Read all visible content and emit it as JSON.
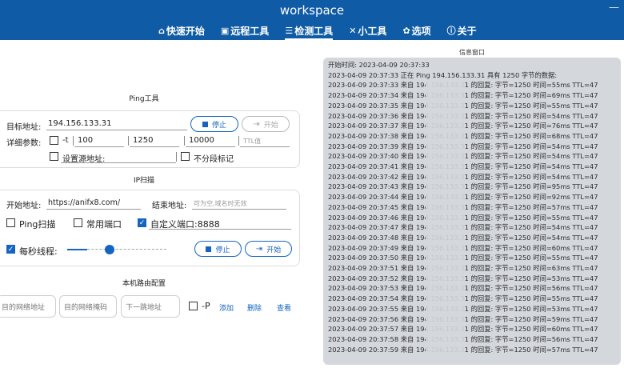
{
  "app": {
    "title": "workspace"
  },
  "nav": [
    {
      "icon": "home-icon",
      "glyph": "⌂",
      "label": "快速开始",
      "active": false
    },
    {
      "icon": "remote-icon",
      "glyph": "▣",
      "label": "远程工具",
      "active": false
    },
    {
      "icon": "wifi-icon",
      "glyph": "☰",
      "label": "检测工具",
      "active": true
    },
    {
      "icon": "tools-icon",
      "glyph": "✕",
      "label": "小工具",
      "active": false
    },
    {
      "icon": "gear-icon",
      "glyph": "✿",
      "label": "选项",
      "active": false
    },
    {
      "icon": "info-icon",
      "glyph": "ⓘ",
      "label": "关于",
      "active": false
    }
  ],
  "ping": {
    "title": "Ping工具",
    "target_label": "目标地址:",
    "target_value": "194.156.133.31",
    "stop_label": "停止",
    "start_label": "开始",
    "detail_label": "详细参数:",
    "t_label": "-t",
    "count": "100",
    "size": "1250",
    "timeout": "10000",
    "ttl_placeholder": "TTL值",
    "source_label": "设置源地址:",
    "nofrag_label": "不分段标记"
  },
  "ipscan": {
    "title": "IP扫描",
    "start_label": "开始地址:",
    "start_value": "https://anifx8.com/",
    "end_label": "结束地址:",
    "end_placeholder": "可为空,域名时无效",
    "ping_scan": "Ping扫描",
    "common_ports": "常用端口",
    "custom_port": "自定义端口:8888",
    "threads_label": "每秒线程:",
    "slider_fraction": 0.2,
    "stop_label": "停止",
    "start_btn": "开始"
  },
  "route": {
    "title": "本机路由配置",
    "dest_placeholder": "目的网络地址",
    "mask_placeholder": "目的网络掩码",
    "gateway_placeholder": "下一跳地址",
    "p_label": "-P",
    "add": "添加",
    "delete": "删除",
    "view": "查看"
  },
  "info": {
    "title": "信息窗口",
    "lines": [
      "开始时间:  2023-04-09 20:37:33",
      "2023-04-09 20:37:33  正在 Ping 194.156.133.31 具有 1250 字节的数据:",
      "2023-04-09 20:37:33  来自 194.156.133.31 的回复: 字节=1250 时间=55ms TTL=47",
      "2023-04-09 20:37:34  来自 194.156.133.31 的回复: 字节=1250 时间=69ms TTL=47",
      "2023-04-09 20:37:35  来自 194.156.133.31 的回复: 字节=1250 时间=55ms TTL=47",
      "2023-04-09 20:37:36  来自 194.156.133.31 的回复: 字节=1250 时间=54ms TTL=47",
      "2023-04-09 20:37:37  来自 194.156.133.31 的回复: 字节=1250 时间=76ms TTL=47",
      "2023-04-09 20:37:38  来自 194.156.133.31 的回复: 字节=1250 时间=68ms TTL=47",
      "2023-04-09 20:37:39  来自 194.156.133.31 的回复: 字节=1250 时间=54ms TTL=47",
      "2023-04-09 20:37:40  来自 194.156.133.31 的回复: 字节=1250 时间=54ms TTL=47",
      "2023-04-09 20:37:41  来自 194.156.133.31 的回复: 字节=1250 时间=54ms TTL=47",
      "2023-04-09 20:37:42  来自 194.156.133.31 的回复: 字节=1250 时间=54ms TTL=47",
      "2023-04-09 20:37:43  来自 194.156.133.31 的回复: 字节=1250 时间=95ms TTL=47",
      "2023-04-09 20:37:44  来自 194.156.133.31 的回复: 字节=1250 时间=92ms TTL=47",
      "2023-04-09 20:37:45  来自 194.156.133.31 的回复: 字节=1250 时间=57ms TTL=47",
      "2023-04-09 20:37:46  来自 194.156.133.31 的回复: 字节=1250 时间=55ms TTL=47",
      "2023-04-09 20:37:47  来自 194.156.133.31 的回复: 字节=1250 时间=54ms TTL=47",
      "2023-04-09 20:37:48  来自 194.156.133.31 的回复: 字节=1250 时间=54ms TTL=47",
      "2023-04-09 20:37:49  来自 194.156.133.31 的回复: 字节=1250 时间=60ms TTL=47",
      "2023-04-09 20:37:50  来自 194.156.133.31 的回复: 字节=1250 时间=55ms TTL=47",
      "2023-04-09 20:37:51  来自 194.156.133.31 的回复: 字节=1250 时间=63ms TTL=47",
      "2023-04-09 20:37:52  来自 194.156.133.31 的回复: 字节=1250 时间=53ms TTL=47",
      "2023-04-09 20:37:53  来自 194.156.133.31 的回复: 字节=1250 时间=56ms TTL=47",
      "2023-04-09 20:37:54  来自 194.156.133.31 的回复: 字节=1250 时间=55ms TTL=47",
      "2023-04-09 20:37:55  来自 194.156.133.31 的回复: 字节=1250 时间=53ms TTL=47",
      "2023-04-09 20:37:56  来自 194.156.133.31 的回复: 字节=1250 时间=59ms TTL=47",
      "2023-04-09 20:37:57  来自 194.156.133.31 的回复: 字节=1250 时间=60ms TTL=47",
      "2023-04-09 20:37:58  来自 194.156.133.31 的回复: 字节=1250 时间=56ms TTL=47",
      "2023-04-09 20:37:59  来自 194.156.133.31 的回复: 字节=1250 时间=57ms TTL=47"
    ]
  },
  "colors": {
    "titlebar": "#0f5ba6",
    "accent": "#1565c0",
    "panel": "#d4d7dc"
  }
}
